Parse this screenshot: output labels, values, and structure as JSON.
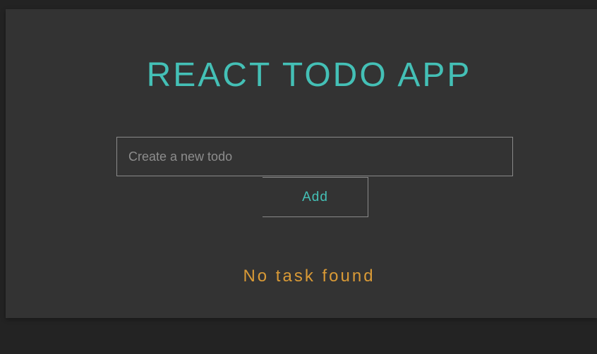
{
  "app": {
    "title": "REACT TODO APP"
  },
  "form": {
    "input_value": "",
    "input_placeholder": "Create a new todo",
    "add_label": "Add"
  },
  "list": {
    "items": [],
    "empty_message": "No task found"
  },
  "colors": {
    "page_background": "#232323",
    "card_background": "#333333",
    "accent": "#44c0b6",
    "empty_message": "#d99a36",
    "border": "#8a8a8a",
    "placeholder": "#8d8d8d"
  }
}
